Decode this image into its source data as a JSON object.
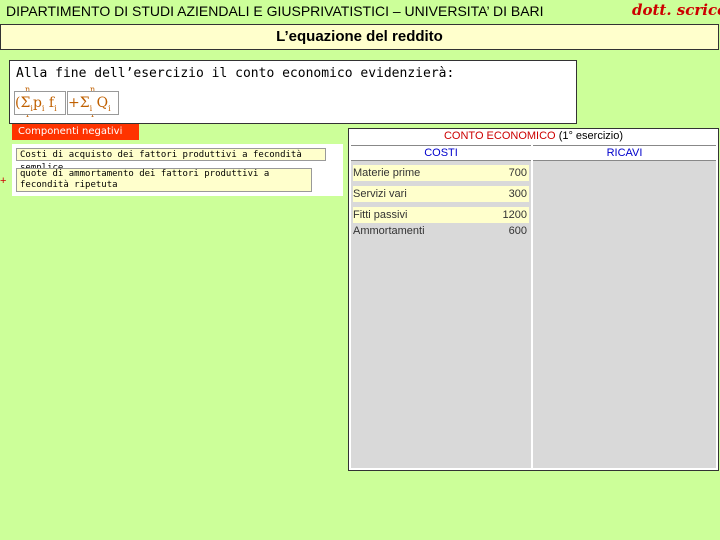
{
  "header": {
    "title": "DIPARTIMENTO DI STUDI AZIENDALI E GIUSPRIVATISTICI – UNIVERSITA’ DI BARI",
    "author": "dott. scricco"
  },
  "subtitle": "L’equazione del reddito",
  "intro": {
    "text": "Alla fine dell’esercizio il conto economico evidenzierà:",
    "formula": {
      "open": "(",
      "sum": "Σ",
      "i": "i",
      "p": "p",
      "f": "f",
      "plus": "+",
      "q": "Q",
      "n": "n",
      "one": "1"
    }
  },
  "negatives": {
    "label": "Componenti negativi",
    "cost1": "Costi di acquisto dei fattori produttivi a fecondità semplice",
    "cost2": "quote di ammortamento dei fattori produttivi a fecondità ripetuta",
    "plus": "+"
  },
  "conto": {
    "title": "CONTO ECONOMICO",
    "subtitle": "(1° esercizio)",
    "costi": "COSTI",
    "ricavi": "RICAVI",
    "rows": [
      {
        "label": "Materie prime",
        "amount": "700"
      },
      {
        "label": "Servizi vari",
        "amount": "300"
      },
      {
        "label": "Fitti passivi",
        "amount": "1200"
      },
      {
        "label": "Ammortamenti",
        "amount": "600"
      }
    ]
  }
}
